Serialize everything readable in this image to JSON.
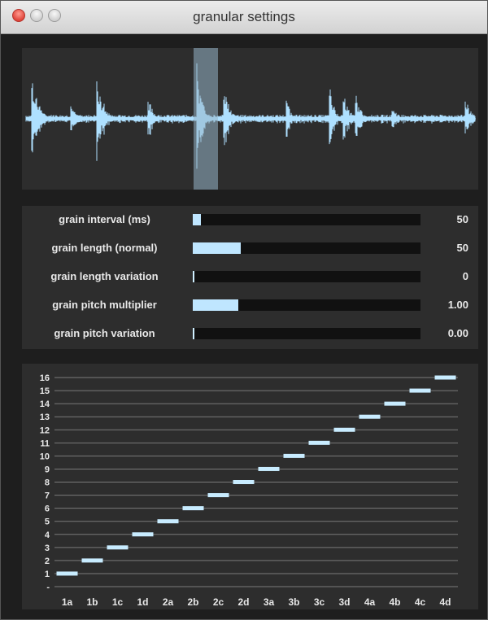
{
  "window": {
    "title": "granular settings"
  },
  "waveform": {
    "selection_start": 0.377,
    "selection_end": 0.43,
    "color": "#aee0ff"
  },
  "sliders": [
    {
      "label": "grain interval (ms)",
      "value": "50",
      "fill": 0.035
    },
    {
      "label": "grain length (normal)",
      "value": "50",
      "fill": 0.21
    },
    {
      "label": "grain length variation",
      "value": "0",
      "fill": 0.0
    },
    {
      "label": "grain pitch multiplier",
      "value": "1.00",
      "fill": 0.2
    },
    {
      "label": "grain pitch variation",
      "value": "0.00",
      "fill": 0.0
    }
  ],
  "sequencer": {
    "y_labels": [
      "-",
      "1",
      "2",
      "3",
      "4",
      "5",
      "6",
      "7",
      "8",
      "9",
      "10",
      "11",
      "12",
      "13",
      "14",
      "15",
      "16"
    ],
    "x_labels": [
      "1a",
      "1b",
      "1c",
      "1d",
      "2a",
      "2b",
      "2c",
      "2d",
      "3a",
      "3b",
      "3c",
      "3d",
      "4a",
      "4b",
      "4c",
      "4d"
    ],
    "values": [
      1,
      2,
      3,
      4,
      5,
      6,
      7,
      8,
      9,
      10,
      11,
      12,
      13,
      14,
      15,
      16
    ],
    "step_color": "#c8ecff"
  }
}
